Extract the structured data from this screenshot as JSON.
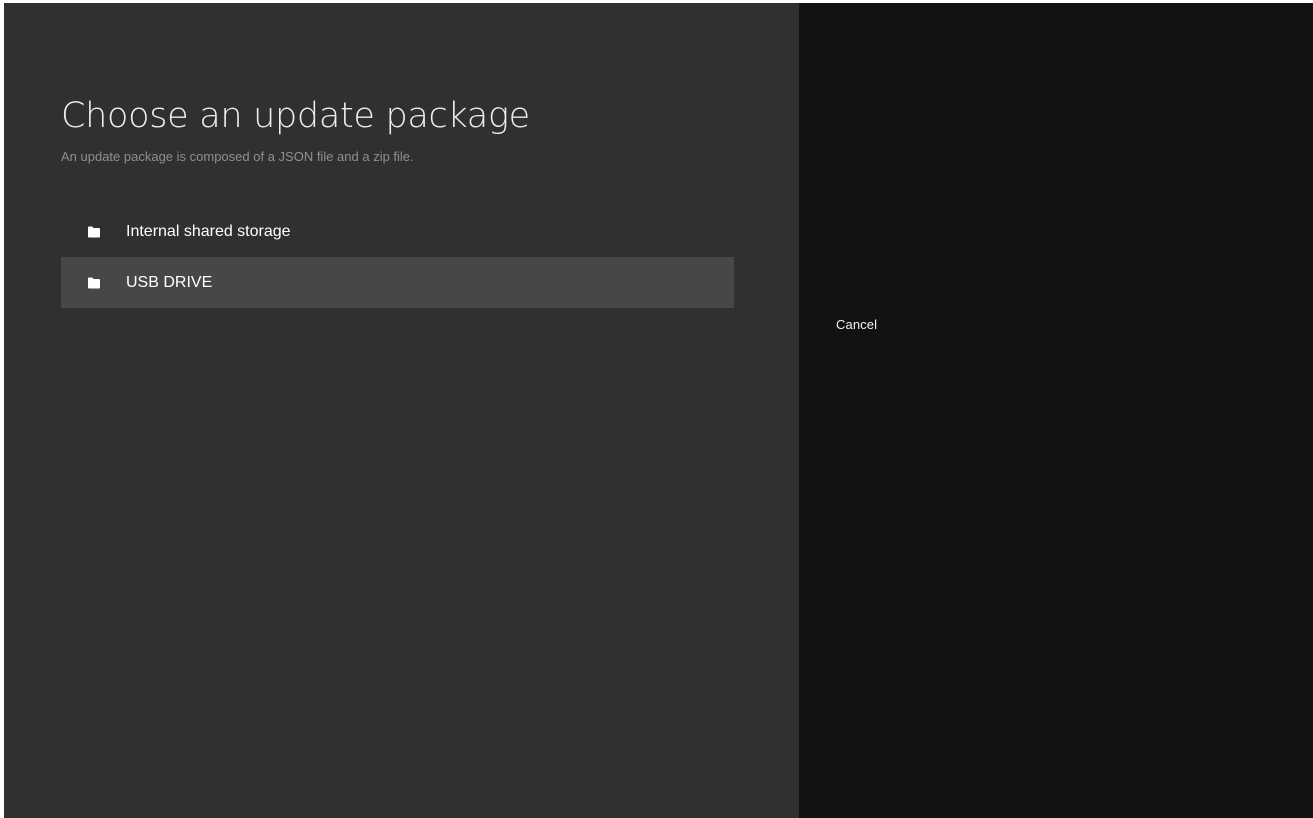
{
  "header": {
    "title": "Choose an update package",
    "subtitle": "An update package is composed of a JSON file and a zip file."
  },
  "storage_list": {
    "items": [
      {
        "label": "Internal shared storage",
        "icon": "folder-icon",
        "focused": false
      },
      {
        "label": "USB DRIVE",
        "icon": "folder-icon",
        "focused": true
      }
    ]
  },
  "actions": {
    "cancel_label": "Cancel"
  },
  "colors": {
    "left_pane_bg": "#303030",
    "right_pane_bg": "#121212",
    "focused_item_bg": "#474747",
    "text_primary": "#ffffff",
    "text_secondary": "#8f8f8f"
  }
}
